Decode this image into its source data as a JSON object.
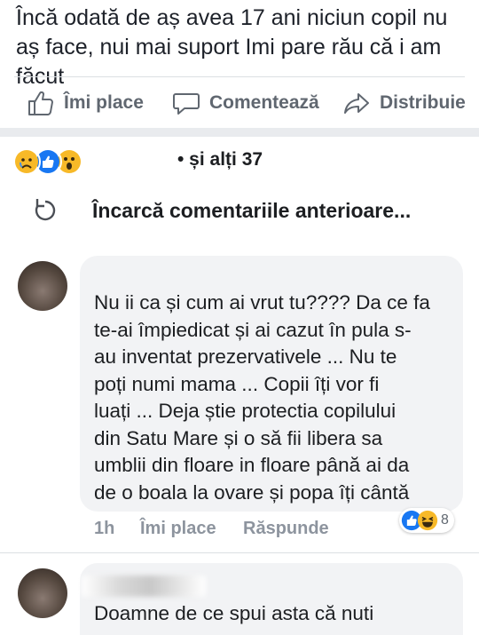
{
  "post": {
    "text": "Încă odată de aș avea 17 ani niciun copil nu aș face, nui mai suport Imi pare rău că i am făcut"
  },
  "actions": {
    "like": "Îmi place",
    "comment": "Comentează",
    "share": "Distribuie"
  },
  "reactions": {
    "icons": [
      "sad-icon",
      "like-icon",
      "wow-icon"
    ],
    "others": "• și alți 37"
  },
  "load_previous": {
    "label": "Încarcă comentariile anterioare..."
  },
  "comments": [
    {
      "text": "Nu ii ca și cum ai vrut tu???? Da ce fa\nte-ai împiedicat și ai cazut în pula  s-\nau inventat prezervativele ... Nu te\npoți numi mama ... Copii îți vor fi\nluați ... Deja știe protectia copilului\ndin Satu Mare și o să fii libera sa\numblii din floare in floare până ai  da\nde o boala la ovare și popa îți cântă",
      "time": "1h",
      "like_label": "Îmi place",
      "reply_label": "Răspunde",
      "reaction_icons": [
        "like-icon",
        "haha-icon"
      ],
      "reaction_count": "8"
    },
    {
      "text": "Doamne de ce spui asta că nuti"
    }
  ],
  "colors": {
    "secondary_text": "#606770",
    "meta_text": "#8d949e",
    "bubble": "#f2f3f5",
    "like_blue": "#1877f2",
    "reaction_yellow": "#f7b928"
  }
}
